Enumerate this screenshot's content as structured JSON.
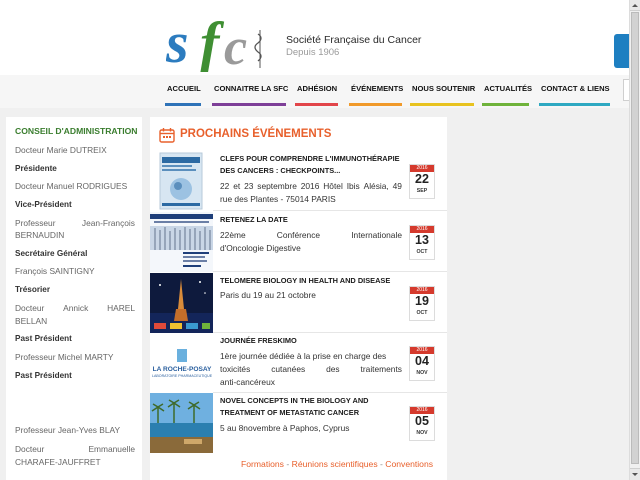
{
  "header": {
    "site_name": "Société Française du Cancer",
    "since": "Depuis 1906"
  },
  "nav": {
    "items": [
      {
        "label": "ACCUEIL",
        "color": "#2f73b8"
      },
      {
        "label": "CONNAITRE LA SFC",
        "color": "#7e3f98"
      },
      {
        "label": "ADHÉSION",
        "color": "#e2454a"
      },
      {
        "label": "ÉVÉNEMENTS",
        "color": "#f19a2a"
      },
      {
        "label": "NOUS SOUTENIR",
        "color": "#e8c31f"
      },
      {
        "label": "ACTUALITÉS",
        "color": "#6fb33b"
      },
      {
        "label": "CONTACT & LIENS",
        "color": "#2fa9c2"
      }
    ]
  },
  "sidebar": {
    "title": "CONSEIL D'ADMINISTRATION",
    "members": [
      {
        "name": "Docteur Marie DUTREIX",
        "role": "Présidente"
      },
      {
        "name": "Docteur Manuel RODRIGUES",
        "role": "Vice-Président"
      },
      {
        "name_line1": [
          "Professeur",
          "Jean-François"
        ],
        "name_line2": "BERNAUDIN",
        "role": "Secrétaire Général"
      },
      {
        "name": "François SAINTIGNY",
        "role": "Trésorier"
      },
      {
        "name_line1": [
          "Docteur",
          "Annick",
          "HAREL"
        ],
        "name_line2": "BELLAN",
        "role": "Past Président"
      },
      {
        "name": "Professeur Michel MARTY",
        "role": "Past Président"
      },
      {
        "name": "Professeur Jean-Yves BLAY"
      },
      {
        "name_line1": [
          "Docteur",
          "Emmanuelle"
        ],
        "name_line2": "CHARAFE-JAUFFRET"
      }
    ]
  },
  "events": {
    "title": "PROCHAINS ÉVÉNEMENTS",
    "items": [
      {
        "title": "CLEFS POUR COMPRENDRE L'IMMUNOTHÉRAPIE DES CANCERS : CHECKPOINTS...",
        "desc_line1": [
          "22",
          "et",
          "23",
          "septembre",
          "2016",
          "Hôtel",
          "Ibis",
          "Alésia,",
          "49"
        ],
        "desc_line2": "rue des Plantes - 75014 PARIS",
        "year": "2016",
        "day": "22",
        "month": "SEP"
      },
      {
        "title": "RETENEZ LA DATE",
        "desc_line1": [
          "22ème",
          "Conférence",
          "Internationale"
        ],
        "desc_line2": "d'Oncologie Digestive",
        "year": "2016",
        "day": "13",
        "month": "OCT"
      },
      {
        "title": "TELOMERE BIOLOGY IN HEALTH AND DISEASE",
        "desc_line2": "Paris du 19 au 21 octobre",
        "year": "2016",
        "day": "19",
        "month": "OCT"
      },
      {
        "title": "JOURNÉE FRESKIMO",
        "desc_line1": [
          "1ère journée dédiée à la prise en charge des"
        ],
        "desc_line1b": [
          "toxicités",
          "cutanées",
          "des",
          "traitements"
        ],
        "desc_line2": "anti-cancéreux",
        "thumb_text": "LA ROCHE-POSAY",
        "thumb_sub": "LABORATOIRE PHARMACEUTIQUE",
        "year": "2016",
        "day": "04",
        "month": "NOV"
      },
      {
        "title": "NOVEL CONCEPTS IN THE BIOLOGY AND TREATMENT OF METASTATIC CANCER",
        "desc_line2": "5 au 8novembre à Paphos, Cyprus",
        "year": "2016",
        "day": "05",
        "month": "NOV"
      }
    ],
    "categories": [
      "Formations",
      "Réunions scientifiques",
      "Conventions"
    ]
  }
}
